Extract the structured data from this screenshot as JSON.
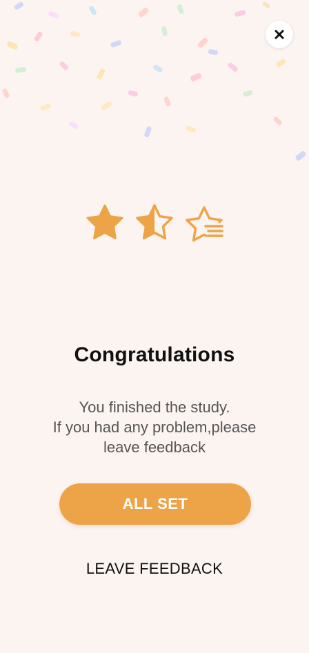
{
  "theme": {
    "accent": "#eda448",
    "background": "#fcf4f1"
  },
  "header": {
    "close_icon": "close-icon"
  },
  "rating": {
    "stars_filled": 1.5,
    "stars_total": 3,
    "icons": [
      "star-filled-icon",
      "star-half-icon",
      "star-list-icon"
    ]
  },
  "content": {
    "title": "Congratulations",
    "message_line1": "You finished the study.",
    "message_line2": "If you had any problem,please",
    "message_line3": "leave feedback"
  },
  "actions": {
    "primary_label": "ALL SET",
    "secondary_label": "LEAVE FEEDBACK"
  }
}
